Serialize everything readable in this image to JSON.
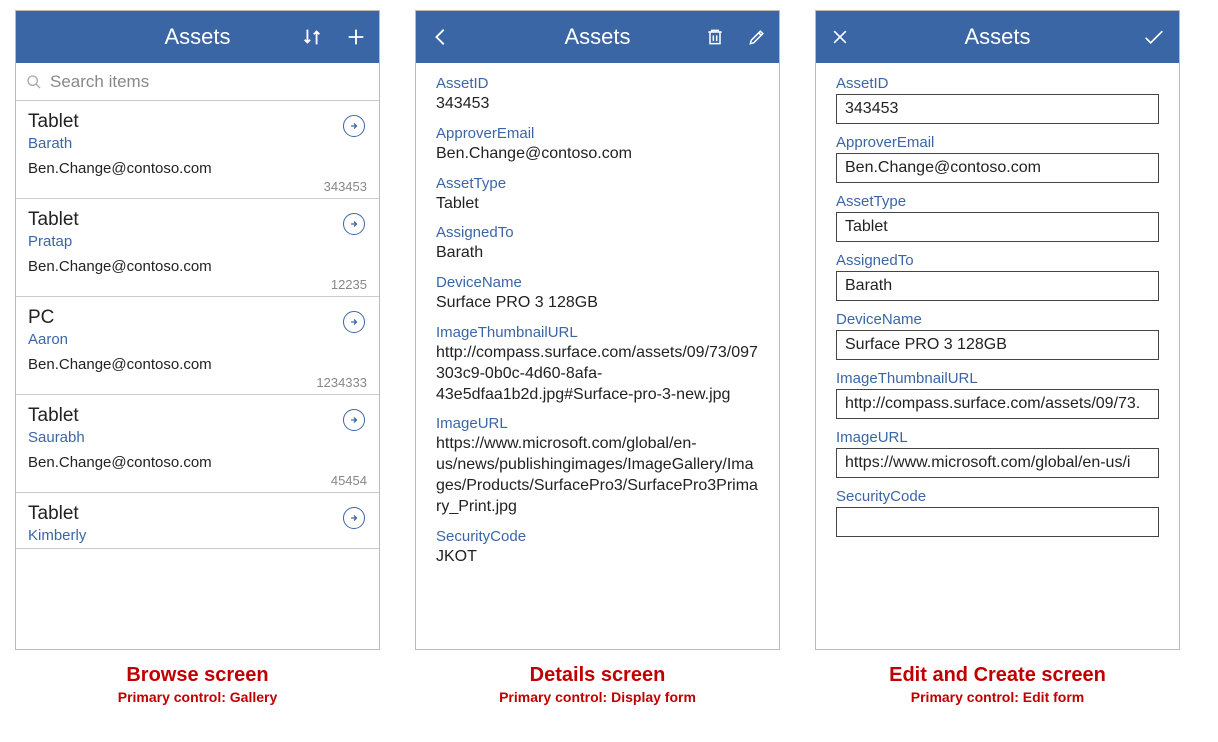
{
  "header_title": "Assets",
  "search_placeholder": "Search items",
  "browse": {
    "items": [
      {
        "title": "Tablet",
        "sub": "Barath",
        "email": "Ben.Change@contoso.com",
        "id": "343453"
      },
      {
        "title": "Tablet",
        "sub": "Pratap",
        "email": "Ben.Change@contoso.com",
        "id": "12235"
      },
      {
        "title": "PC",
        "sub": "Aaron",
        "email": "Ben.Change@contoso.com",
        "id": "1234333"
      },
      {
        "title": "Tablet",
        "sub": "Saurabh",
        "email": "Ben.Change@contoso.com",
        "id": "45454"
      },
      {
        "title": "Tablet",
        "sub": "Kimberly",
        "email": "",
        "id": ""
      }
    ]
  },
  "details": {
    "fields": [
      {
        "label": "AssetID",
        "value": "343453"
      },
      {
        "label": "ApproverEmail",
        "value": "Ben.Change@contoso.com"
      },
      {
        "label": "AssetType",
        "value": "Tablet"
      },
      {
        "label": "AssignedTo",
        "value": "Barath"
      },
      {
        "label": "DeviceName",
        "value": "Surface PRO 3 128GB"
      },
      {
        "label": "ImageThumbnailURL",
        "value": "http://compass.surface.com/assets/09/73/097303c9-0b0c-4d60-8afa-43e5dfaa1b2d.jpg#Surface-pro-3-new.jpg"
      },
      {
        "label": "ImageURL",
        "value": "https://www.microsoft.com/global/en-us/news/publishingimages/ImageGallery/Images/Products/SurfacePro3/SurfacePro3Primary_Print.jpg"
      },
      {
        "label": "SecurityCode",
        "value": "JKOT"
      }
    ]
  },
  "edit": {
    "fields": [
      {
        "label": "AssetID",
        "value": "343453"
      },
      {
        "label": "ApproverEmail",
        "value": "Ben.Change@contoso.com"
      },
      {
        "label": "AssetType",
        "value": "Tablet"
      },
      {
        "label": "AssignedTo",
        "value": "Barath"
      },
      {
        "label": "DeviceName",
        "value": "Surface PRO 3 128GB"
      },
      {
        "label": "ImageThumbnailURL",
        "value": "http://compass.surface.com/assets/09/73."
      },
      {
        "label": "ImageURL",
        "value": "https://www.microsoft.com/global/en-us/i"
      },
      {
        "label": "SecurityCode",
        "value": ""
      }
    ]
  },
  "captions": {
    "browse": {
      "title": "Browse screen",
      "sub": "Primary control: Gallery"
    },
    "details": {
      "title": "Details screen",
      "sub": "Primary control: Display form"
    },
    "edit": {
      "title": "Edit and Create screen",
      "sub": "Primary control: Edit form"
    }
  }
}
